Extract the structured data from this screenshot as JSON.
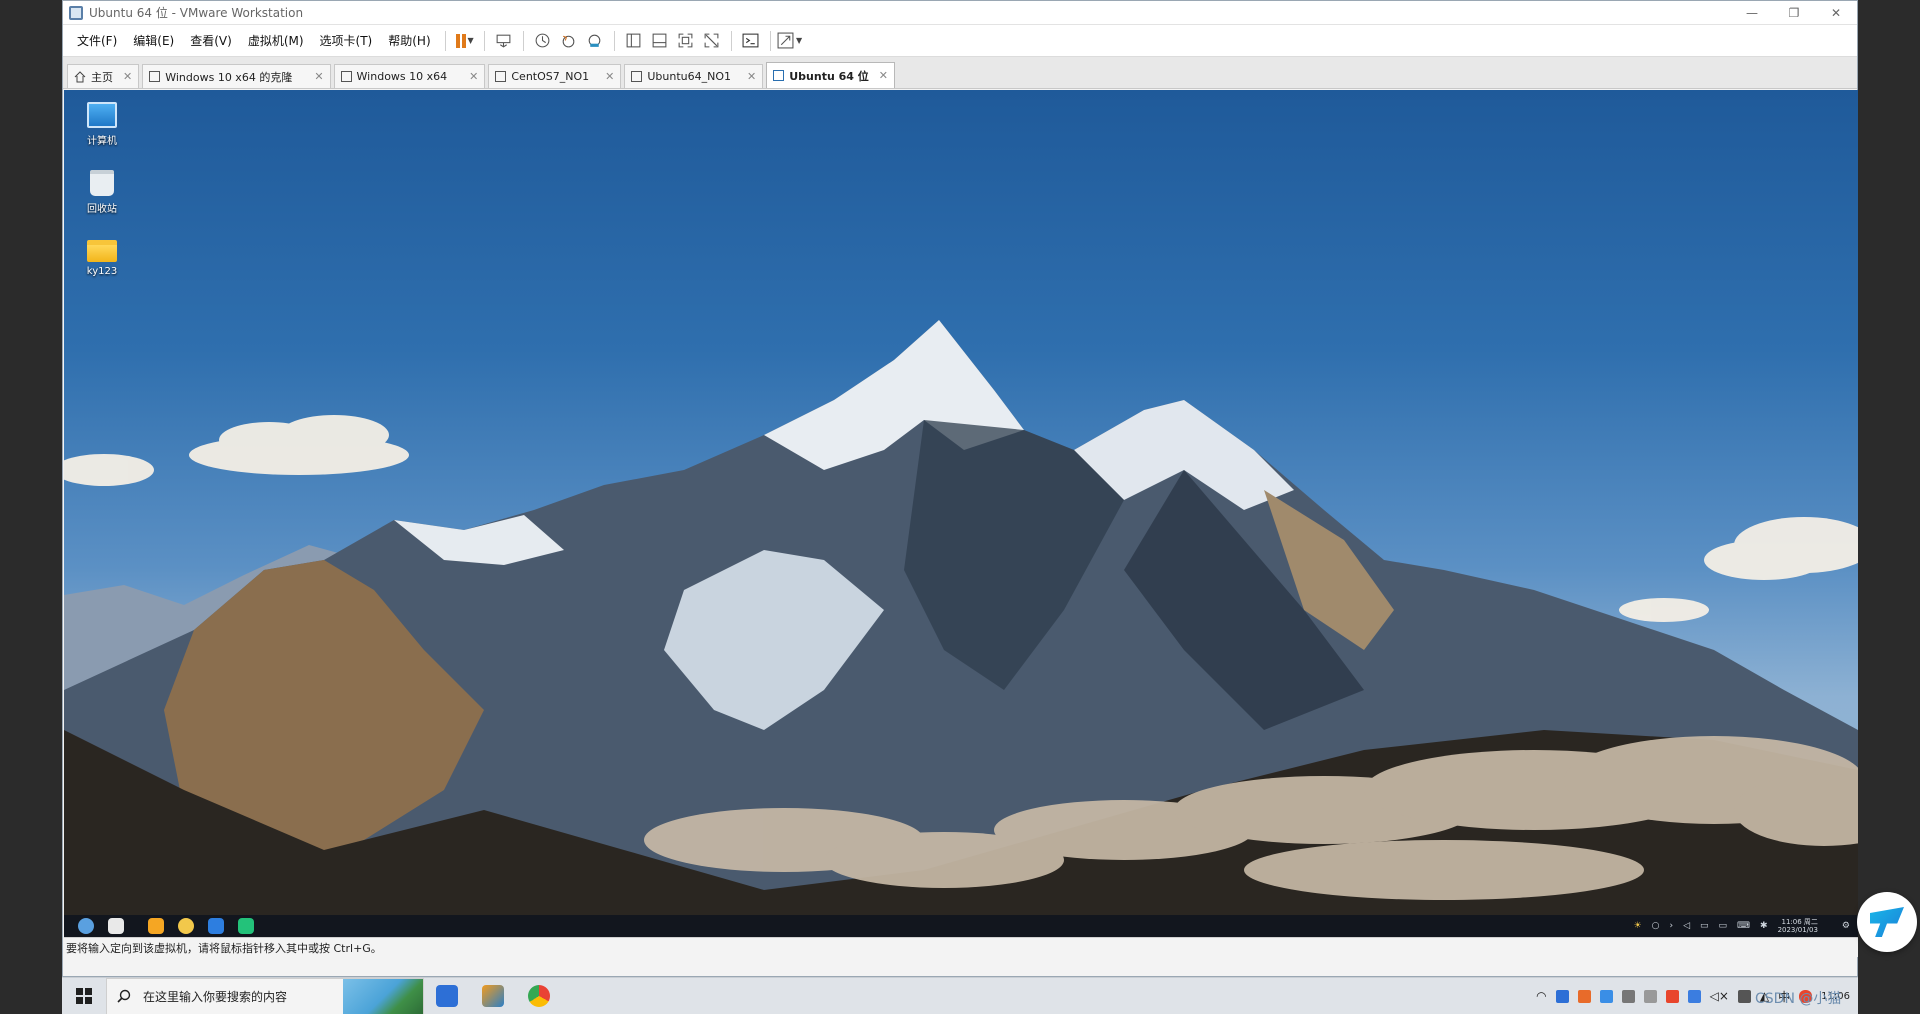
{
  "window": {
    "title": "Ubuntu 64 位 - VMware Workstation",
    "minimize_glyph": "—",
    "restore_glyph": "❐",
    "close_glyph": "✕"
  },
  "menubar": {
    "items": [
      "文件(F)",
      "编辑(E)",
      "查看(V)",
      "虚拟机(M)",
      "选项卡(T)",
      "帮助(H)"
    ]
  },
  "toolbar": {
    "icons": [
      "pause-icon",
      "send-keys-icon",
      "snapshot-icon",
      "revert-snapshot-icon",
      "snapshot-manager-icon",
      "sidebar-icon",
      "thumbnail-icon",
      "fullscreen-icon",
      "unity-icon",
      "console-icon",
      "stretch-icon"
    ]
  },
  "tabs": [
    {
      "label": "主页",
      "icon": "home-icon",
      "active": false
    },
    {
      "label": "Windows 10 x64 的克隆",
      "icon": "vm-icon",
      "active": false
    },
    {
      "label": "Windows 10 x64",
      "icon": "vm-icon",
      "active": false
    },
    {
      "label": "CentOS7_NO1",
      "icon": "vm-icon",
      "active": false
    },
    {
      "label": "Ubuntu64_NO1",
      "icon": "vm-icon",
      "active": false
    },
    {
      "label": "Ubuntu 64 位",
      "icon": "vm-icon",
      "active": true
    }
  ],
  "desktop": {
    "icons": [
      {
        "label": "计算机",
        "icon": "computer-icon"
      },
      {
        "label": "回收站",
        "icon": "trash-icon"
      },
      {
        "label": "ky123",
        "icon": "folder-icon"
      }
    ]
  },
  "vm_taskbar": {
    "clock_time": "11:06 周二",
    "clock_date": "2023/01/03"
  },
  "statusbar": {
    "text": "要将输入定向到该虚拟机，请将鼠标指针移入其中或按 Ctrl+G。"
  },
  "host_taskbar": {
    "search_placeholder": "在这里输入你要搜索的内容",
    "tray_ime": "中",
    "tray_lang": "中",
    "clock_time": "11:06",
    "watermark": "CSDN @小猫"
  }
}
